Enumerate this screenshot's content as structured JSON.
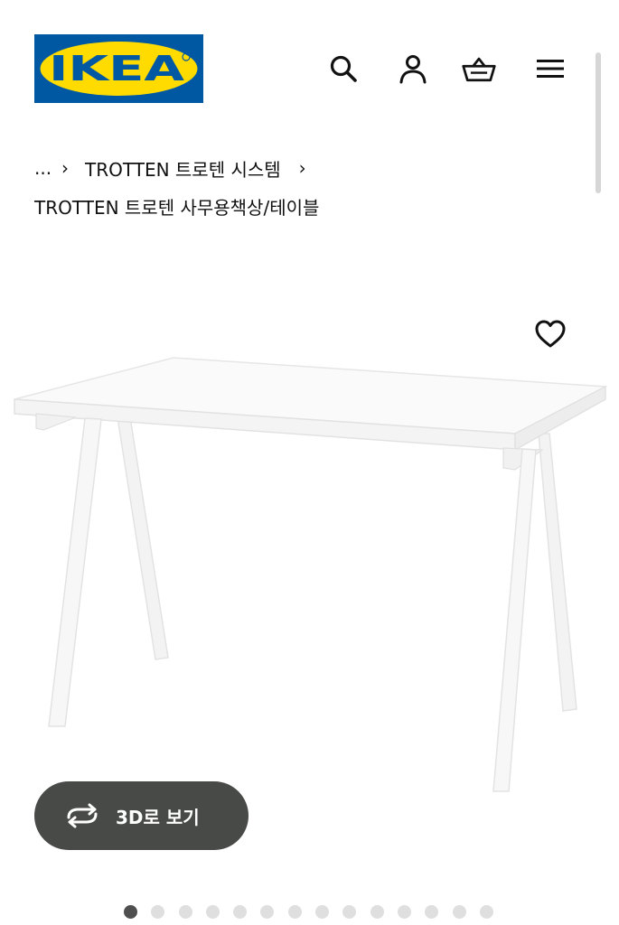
{
  "header": {
    "logo_text": "IKEA",
    "logo_colors": {
      "blue": "#0058a3",
      "yellow": "#ffdb00"
    },
    "icons": [
      "search-icon",
      "account-icon",
      "cart-icon",
      "menu-icon"
    ]
  },
  "breadcrumb": {
    "ellipsis": "...",
    "separator": "›",
    "items": [
      "TROTTEN 트로텐 시스템"
    ]
  },
  "product": {
    "title": "TROTTEN 트로텐 사무용책상/테이블",
    "favorite_icon": "heart-icon",
    "image_alt": "TROTTEN 사무용책상/테이블"
  },
  "view3d": {
    "label": "3D로 보기",
    "icon": "rotate-3d-icon"
  },
  "carousel": {
    "total": 14,
    "active": 1
  },
  "colors": {
    "button_bg": "#484a47",
    "dot_active": "#4f4f4f",
    "dot_inactive": "#dfdfdf"
  }
}
